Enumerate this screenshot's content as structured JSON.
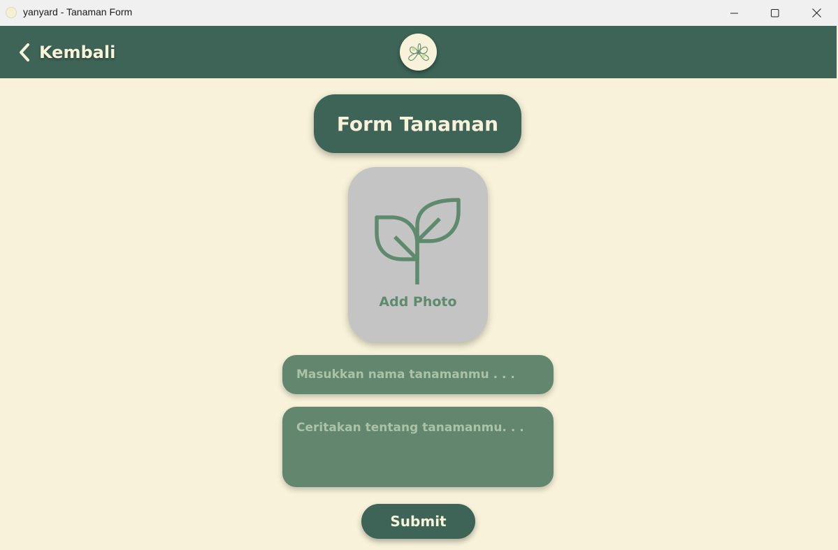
{
  "window": {
    "title": "yanyard - Tanaman Form"
  },
  "header": {
    "back_label": "Kembali"
  },
  "form": {
    "title": "Form Tanaman",
    "photo_label": "Add Photo",
    "name_placeholder": "Masukkan nama tanamanmu . . .",
    "desc_placeholder": "Ceritakan tentang tanamanmu. . .",
    "submit_label": "Submit"
  },
  "colors": {
    "primary": "#3d6457",
    "background": "#f7f2d9",
    "input": "#63876e",
    "photo_box": "#c4c4c4",
    "accent_text": "#5e8a6d"
  },
  "icons": {
    "back": "chevron-left-icon",
    "photo": "sprout-icon",
    "logo": "plant-logo"
  }
}
